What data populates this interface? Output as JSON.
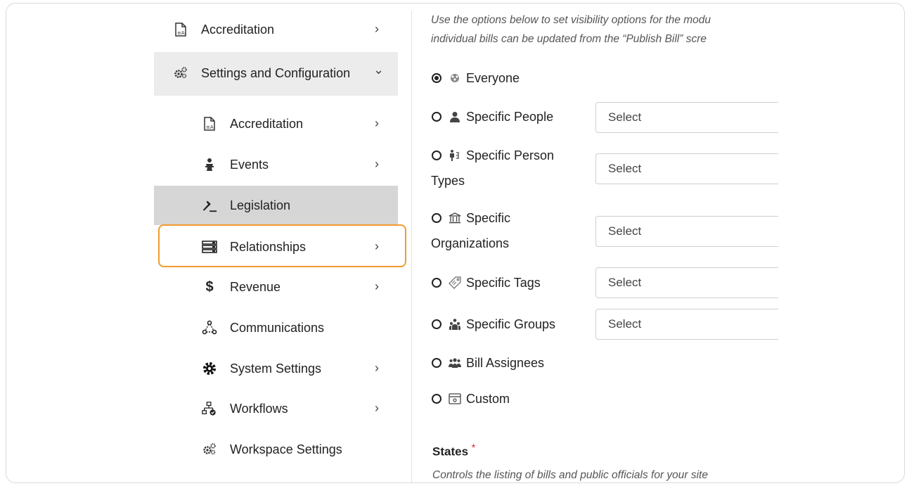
{
  "sidebar": {
    "top_item": {
      "label": "Accreditation",
      "icon": "document-icon"
    },
    "section": {
      "label": "Settings and Configuration",
      "icon": "gears-icon",
      "expanded": true
    },
    "items": [
      {
        "label": "Accreditation",
        "icon": "document-icon",
        "has_chevron": true
      },
      {
        "label": "Events",
        "icon": "podium-icon",
        "has_chevron": true
      },
      {
        "label": "Legislation",
        "icon": "gavel-icon",
        "has_chevron": false,
        "active": true
      },
      {
        "label": "Relationships",
        "icon": "server-icon",
        "has_chevron": true,
        "focused": true
      },
      {
        "label": "Revenue",
        "icon": "dollar-icon",
        "has_chevron": true
      },
      {
        "label": "Communications",
        "icon": "network-icon",
        "has_chevron": false
      },
      {
        "label": "System Settings",
        "icon": "cog-icon",
        "has_chevron": true
      },
      {
        "label": "Workflows",
        "icon": "sitemap-icon",
        "has_chevron": true
      },
      {
        "label": "Workspace Settings",
        "icon": "gears-icon",
        "has_chevron": false
      }
    ],
    "chevron_right": "›",
    "chevron_down": "⌄"
  },
  "main": {
    "intro_line1": "Use the options below to set visibility options for the modu",
    "intro_line2": "individual bills can be updated from the “Publish Bill” scre",
    "options": [
      {
        "label": "Everyone",
        "icon": "globe-people-icon",
        "selected": true
      },
      {
        "label": "Specific People",
        "icon": "person-icon",
        "selected": false,
        "select_placeholder": "Select"
      },
      {
        "label_line1": "Specific Person",
        "label_line2": "Types",
        "icon": "person-types-icon",
        "selected": false,
        "select_placeholder": "Select"
      },
      {
        "label_line1": "Specific",
        "label_line2": "Organizations",
        "icon": "bank-icon",
        "selected": false,
        "select_placeholder": "Select"
      },
      {
        "label": "Specific Tags",
        "icon": "tag-icon",
        "selected": false,
        "select_placeholder": "Select"
      },
      {
        "label": "Specific Groups",
        "icon": "group-icon",
        "selected": false,
        "select_placeholder": "Select"
      },
      {
        "label": "Bill Assignees",
        "icon": "assignees-icon",
        "selected": false
      },
      {
        "label": "Custom",
        "icon": "custom-box-icon",
        "selected": false
      }
    ],
    "states_heading": "States",
    "states_required": "*",
    "states_desc": "Controls the listing of bills and public officials for your site"
  },
  "colors": {
    "focus_ring": "#f29a2e",
    "required": "#e0262c",
    "active_bg": "#d6d6d6",
    "section_bg": "#ececec"
  }
}
